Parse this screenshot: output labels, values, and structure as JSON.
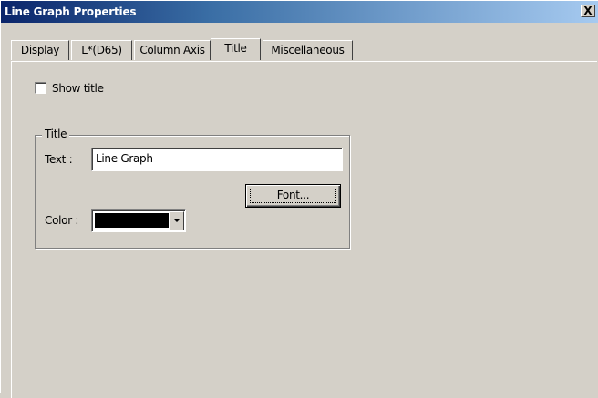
{
  "window": {
    "title": "Line Graph Properties",
    "close_glyph": "X"
  },
  "tabs": [
    {
      "label": "Display"
    },
    {
      "label": "L*(D65)"
    },
    {
      "label": "Column Axis"
    },
    {
      "label": "Title",
      "active": true
    },
    {
      "label": "Miscellaneous"
    }
  ],
  "show_title": {
    "label": "Show title",
    "checked": false
  },
  "title_group": {
    "legend": "Title",
    "text_label": "Text :",
    "text_value": "Line Graph",
    "font_button": "Font...",
    "color_label": "Color :",
    "color_value": "#000000"
  },
  "colors": {
    "face": "#d4d0c8",
    "title_bar": "#0a246a"
  },
  "icons": {
    "dropdown": "chevron-down-icon",
    "close": "close-icon"
  }
}
